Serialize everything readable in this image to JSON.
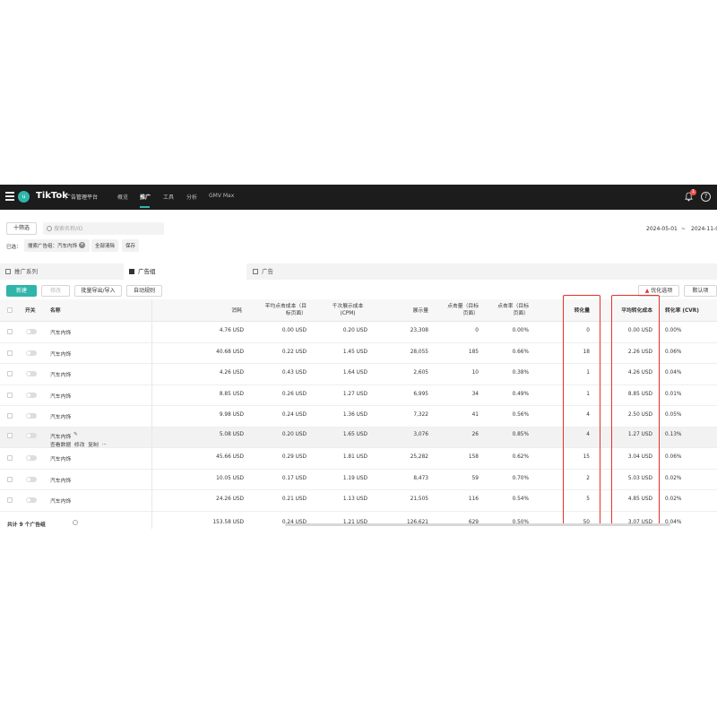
{
  "topbar": {
    "avatar_letter": "u",
    "logo": "TikTok",
    "logo_sub": "广告管理平台",
    "nav": [
      "概览",
      "推广",
      "工具",
      "分析",
      "GMV Max"
    ],
    "active_nav": "推广",
    "notification_count": "1",
    "help": "?"
  },
  "filters": {
    "filter_button": "十筛选",
    "search_placeholder": "搜索名称/ID",
    "date_start": "2024-05-01",
    "date_sep": "~",
    "date_end": "2024-11-0",
    "selected_label": "已选：",
    "chip_text": "搜索广告组：汽车内饰",
    "clear_all": "全部清除",
    "save": "保存"
  },
  "tabs": [
    "推广系列",
    "广告组",
    "广告"
  ],
  "toolbar": {
    "new": "新建",
    "edit": "修改",
    "bulk": "批量导出/导入",
    "auto_rules": "自动规则",
    "optimize": "优化选项",
    "default_view": "默认项"
  },
  "columns": {
    "switch": "开关",
    "name": "名称",
    "spend": "消耗",
    "cpc": "平均点击成本（目标页面）",
    "cpm": "千次展示成本 (CPM)",
    "impressions": "展示量",
    "clicks": "点击量（目标页面）",
    "ctr": "点击率（目标页面）",
    "conversions": "转化量",
    "cpa": "平均转化成本",
    "cvr": "转化率 (CVR)"
  },
  "rows": [
    {
      "name": "汽车内饰",
      "spend": "4.76 USD",
      "cpc": "0.00 USD",
      "cpm": "0.20 USD",
      "impressions": "23,308",
      "clicks": "0",
      "ctr": "0.00%",
      "conversions": "0",
      "cpa": "0.00 USD",
      "cvr": "0.00%"
    },
    {
      "name": "汽车内饰",
      "spend": "40.68 USD",
      "cpc": "0.22 USD",
      "cpm": "1.45 USD",
      "impressions": "28,055",
      "clicks": "185",
      "ctr": "0.66%",
      "conversions": "18",
      "cpa": "2.26 USD",
      "cvr": "0.06%"
    },
    {
      "name": "汽车内饰",
      "spend": "4.26 USD",
      "cpc": "0.43 USD",
      "cpm": "1.64 USD",
      "impressions": "2,605",
      "clicks": "10",
      "ctr": "0.38%",
      "conversions": "1",
      "cpa": "4.26 USD",
      "cvr": "0.04%"
    },
    {
      "name": "汽车内饰",
      "spend": "8.85 USD",
      "cpc": "0.26 USD",
      "cpm": "1.27 USD",
      "impressions": "6,995",
      "clicks": "34",
      "ctr": "0.49%",
      "conversions": "1",
      "cpa": "8.85 USD",
      "cvr": "0.01%"
    },
    {
      "name": "汽车内饰",
      "spend": "9.98 USD",
      "cpc": "0.24 USD",
      "cpm": "1.36 USD",
      "impressions": "7,322",
      "clicks": "41",
      "ctr": "0.56%",
      "conversions": "4",
      "cpa": "2.50 USD",
      "cvr": "0.05%"
    },
    {
      "name": "汽车内饰",
      "spend": "5.08 USD",
      "cpc": "0.20 USD",
      "cpm": "1.65 USD",
      "impressions": "3,076",
      "clicks": "26",
      "ctr": "0.85%",
      "conversions": "4",
      "cpa": "1.27 USD",
      "cvr": "0.13%",
      "actions": [
        "查看数据",
        "修改",
        "复制",
        "···"
      ]
    },
    {
      "name": "汽车内饰",
      "spend": "45.66 USD",
      "cpc": "0.29 USD",
      "cpm": "1.81 USD",
      "impressions": "25,282",
      "clicks": "158",
      "ctr": "0.62%",
      "conversions": "15",
      "cpa": "3.04 USD",
      "cvr": "0.06%"
    },
    {
      "name": "汽车内饰",
      "spend": "10.05 USD",
      "cpc": "0.17 USD",
      "cpm": "1.19 USD",
      "impressions": "8,473",
      "clicks": "59",
      "ctr": "0.70%",
      "conversions": "2",
      "cpa": "5.03 USD",
      "cvr": "0.02%"
    },
    {
      "name": "汽车内饰",
      "spend": "24.26 USD",
      "cpc": "0.21 USD",
      "cpm": "1.13 USD",
      "impressions": "21,505",
      "clicks": "116",
      "ctr": "0.54%",
      "conversions": "5",
      "cpa": "4.85 USD",
      "cvr": "0.02%"
    }
  ],
  "total": {
    "label": "共计 9 个广告组",
    "spend": "153.58 USD",
    "cpc": "0.24 USD",
    "cpm": "1.21 USD",
    "impressions": "126,621",
    "clicks": "629",
    "ctr": "0.50%",
    "conversions": "50",
    "cpa": "3.07 USD",
    "cvr": "0.04%"
  },
  "colors": {
    "accent": "#2fb5a9",
    "highlight_box": "#e8302a",
    "topbar": "#1c1c1c"
  }
}
